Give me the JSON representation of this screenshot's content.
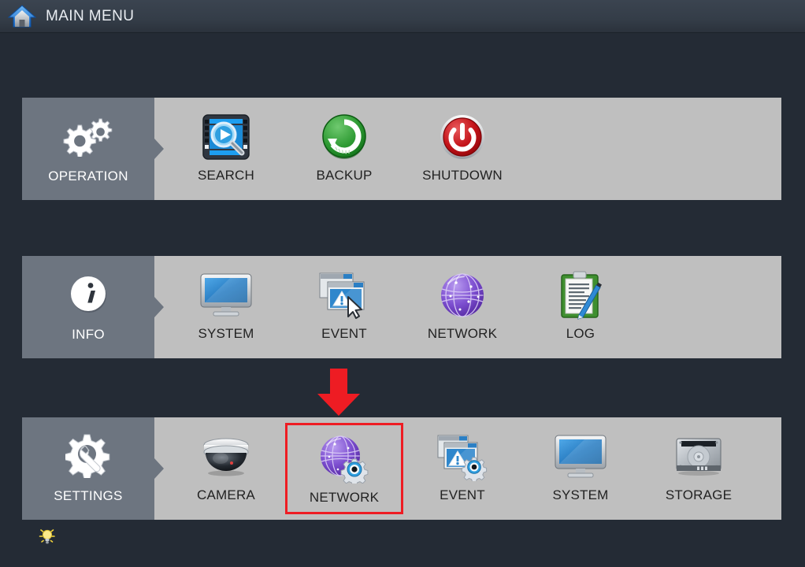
{
  "header": {
    "title": "MAIN MENU",
    "icon": "home-icon"
  },
  "colors": {
    "background": "#242b35",
    "category_panel": "#6d7580",
    "items_panel": "#bfbfbf",
    "header_bar": "#343d48",
    "selection_highlight": "#ee1c23",
    "annotation_arrow": "#ee1c23",
    "label_light": "#ffffff",
    "label_dark": "#222222"
  },
  "rows": [
    {
      "key": "operation",
      "category": {
        "label": "OPERATION",
        "icon": "gears-icon"
      },
      "items": [
        {
          "label": "SEARCH",
          "icon": "video-search-icon",
          "selected": false
        },
        {
          "label": "BACKUP",
          "icon": "backup-circle-icon",
          "selected": false
        },
        {
          "label": "SHUTDOWN",
          "icon": "power-icon",
          "selected": false
        }
      ]
    },
    {
      "key": "info",
      "category": {
        "label": "INFO",
        "icon": "info-circle-icon"
      },
      "items": [
        {
          "label": "SYSTEM",
          "icon": "monitor-icon",
          "selected": false
        },
        {
          "label": "EVENT",
          "icon": "event-windows-icon",
          "selected": false
        },
        {
          "label": "NETWORK",
          "icon": "globe-icon",
          "selected": false
        },
        {
          "label": "LOG",
          "icon": "clipboard-pen-icon",
          "selected": false
        }
      ]
    },
    {
      "key": "settings",
      "category": {
        "label": "SETTINGS",
        "icon": "gear-wrench-icon"
      },
      "items": [
        {
          "label": "CAMERA",
          "icon": "dome-camera-icon",
          "selected": false
        },
        {
          "label": "NETWORK",
          "icon": "globe-gear-icon",
          "selected": true
        },
        {
          "label": "EVENT",
          "icon": "event-windows-gear-icon",
          "selected": false
        },
        {
          "label": "SYSTEM",
          "icon": "monitor-icon",
          "selected": false
        },
        {
          "label": "STORAGE",
          "icon": "harddisk-icon",
          "selected": false
        }
      ]
    }
  ],
  "annotations": {
    "arrow": {
      "icon": "down-arrow-annotation",
      "points_to": "NETWORK"
    },
    "hint": {
      "icon": "lightbulb-icon"
    }
  }
}
